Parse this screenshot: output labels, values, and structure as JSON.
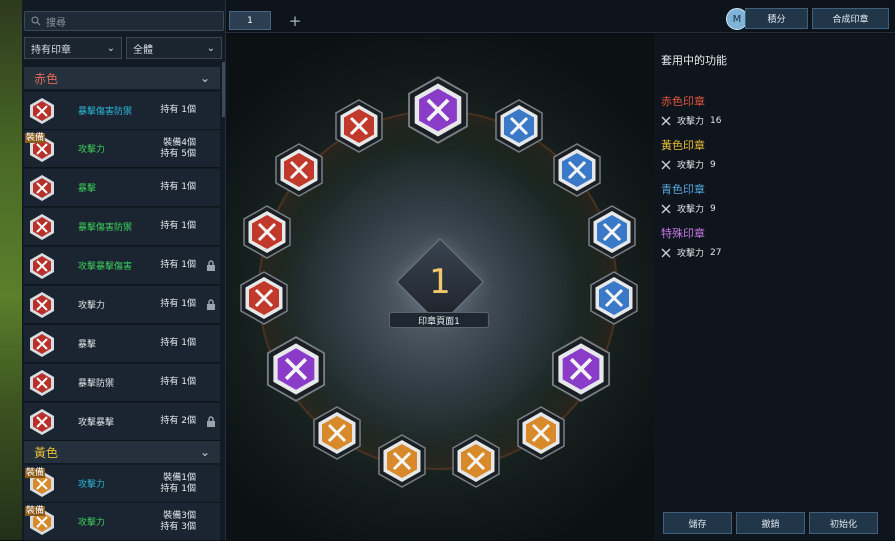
{
  "search": {
    "placeholder": "搜尋"
  },
  "filters": {
    "owned": "持有印章",
    "scope": "全體"
  },
  "tabs": {
    "active": "1",
    "add": "+"
  },
  "top_buttons": {
    "points": "積分",
    "synthesize": "合成印章"
  },
  "sections": {
    "red": "赤色",
    "yellow": "黃色"
  },
  "list": [
    {
      "name": "暴擊傷害防禦",
      "count": "持有 1個",
      "color": "#2cb6d8",
      "equipped": ""
    },
    {
      "name": "攻擊力",
      "count": "裝備4個\n持有 5個",
      "color": "#3ccf5a",
      "equipped": "裝備"
    },
    {
      "name": "暴擊",
      "count": "持有 1個",
      "color": "#3ccf5a",
      "equipped": ""
    },
    {
      "name": "暴擊傷害防禦",
      "count": "持有 1個",
      "color": "#3ccf5a",
      "equipped": ""
    },
    {
      "name": "攻擊暴擊傷害",
      "count": "持有 1個",
      "color": "#3ccf5a",
      "equipped": "",
      "locked": true
    },
    {
      "name": "攻擊力",
      "count": "持有 1個",
      "color": "#e0e4e8",
      "equipped": "",
      "locked": true
    },
    {
      "name": "暴擊",
      "count": "持有 1個",
      "color": "#e0e4e8",
      "equipped": ""
    },
    {
      "name": "暴擊防禦",
      "count": "持有 1個",
      "color": "#e0e4e8",
      "equipped": ""
    },
    {
      "name": "攻擊暴擊",
      "count": "持有 2個",
      "color": "#e0e4e8",
      "equipped": "",
      "locked": true
    },
    {
      "name": "攻擊力",
      "count": "裝備1個\n持有 1個",
      "color": "#2cb6d8",
      "equipped": "裝備"
    },
    {
      "name": "攻擊力",
      "count": "裝備3個\n持有 3個",
      "color": "#3ccf5a",
      "equipped": "裝備"
    }
  ],
  "center": {
    "number": "1",
    "label": "印章頁面1"
  },
  "right_panel": {
    "title": "套用中的功能",
    "groups": [
      {
        "name": "赤色印章",
        "color": "#e0573f",
        "stat": "攻擊力",
        "value": "16"
      },
      {
        "name": "黃色印章",
        "color": "#e8c038",
        "stat": "攻擊力",
        "value": "9"
      },
      {
        "name": "青色印章",
        "color": "#58a8e0",
        "stat": "攻擊力",
        "value": "9"
      },
      {
        "name": "特殊印章",
        "color": "#c878e8",
        "stat": "攻擊力",
        "value": "27"
      }
    ]
  },
  "bottom_buttons": {
    "save": "儲存",
    "cancel": "撤銷",
    "reset": "初始化"
  },
  "colors": {
    "red": "#c0392b",
    "blue": "#3a78c8",
    "orange": "#d88a2a",
    "purple": "#8a3cc8"
  }
}
